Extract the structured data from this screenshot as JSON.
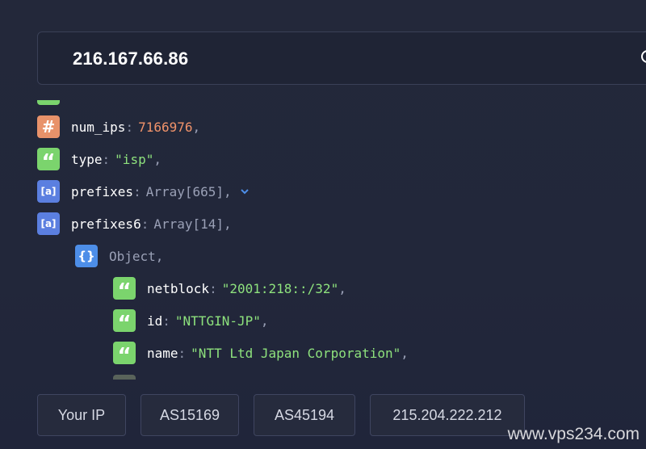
{
  "search": {
    "value": "216.167.66.86"
  },
  "json_viewer": {
    "rows": [
      {
        "type": "number",
        "badge": "#",
        "key": "num_ips",
        "value": "7166976",
        "trail": ","
      },
      {
        "type": "string",
        "badge": "“",
        "key": "type",
        "value": "\"isp\"",
        "trail": ","
      },
      {
        "type": "array",
        "badge": "[a]",
        "key": "prefixes",
        "value": "Array[665]",
        "trail": ",",
        "expandable": true
      },
      {
        "type": "array",
        "badge": "[a]",
        "key": "prefixes6",
        "value": "Array[14]",
        "trail": ","
      },
      {
        "type": "object",
        "badge": "{}",
        "key": "",
        "value": "Object",
        "trail": ","
      },
      {
        "type": "string",
        "badge": "“",
        "key": "netblock",
        "value": "\"2001:218::/32\"",
        "trail": ","
      },
      {
        "type": "string",
        "badge": "“",
        "key": "id",
        "value": "\"NTTGIN-JP\"",
        "trail": ","
      },
      {
        "type": "string",
        "badge": "“",
        "key": "name",
        "value": "\"NTT Ltd Japan Corporation\"",
        "trail": ","
      }
    ]
  },
  "quick_links": [
    "Your IP",
    "AS15169",
    "AS45194",
    "215.204.222.212"
  ],
  "watermark": "www.vps234.com",
  "colors": {
    "background": "#22273a",
    "number_badge": "#e8926a",
    "string_badge": "#7bd46d",
    "array_badge": "#5b7fe0",
    "object_badge": "#4d8ee8",
    "number_value": "#f0936a",
    "string_value": "#8ee27d"
  },
  "icons": {
    "search": "search-icon",
    "expand": "chevron-down-icon"
  }
}
